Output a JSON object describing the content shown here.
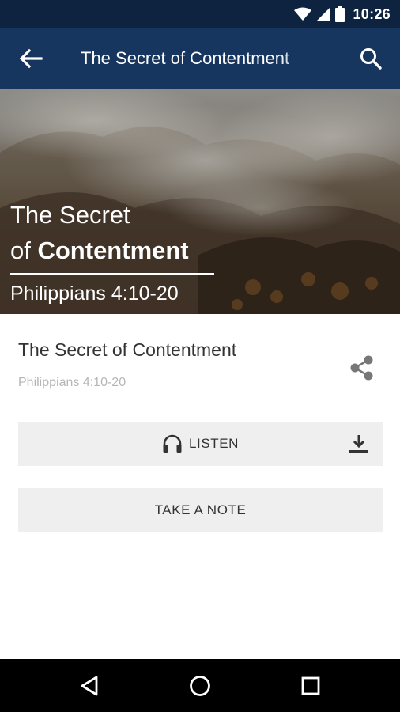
{
  "status_bar": {
    "time": "10:26",
    "icons": [
      "wifi-icon",
      "signal-icon",
      "battery-icon"
    ]
  },
  "app_bar": {
    "title": "The Secret of Contentment",
    "icons": [
      "back-arrow-icon",
      "search-icon"
    ]
  },
  "hero": {
    "title_line1": "The Secret",
    "title_line2_prefix": "of",
    "title_line2_bold": "Contentment",
    "reference": "Philippians 4:10-20"
  },
  "sermon": {
    "title": "The Secret of Contentment",
    "reference": "Philippians 4:10-20",
    "share_icon": "share-icon"
  },
  "actions": {
    "listen_label": "LISTEN",
    "listen_icon": "headphones-icon",
    "download_icon": "download-icon",
    "note_label": "TAKE A NOTE"
  },
  "nav_bar": {
    "icons": [
      "back-triangle-icon",
      "home-circle-icon",
      "recents-square-icon"
    ]
  },
  "colors": {
    "status_bar": "#0d2340",
    "app_bar": "#16355f",
    "button_bg": "#efefef",
    "muted_text": "#b7b7b7"
  }
}
